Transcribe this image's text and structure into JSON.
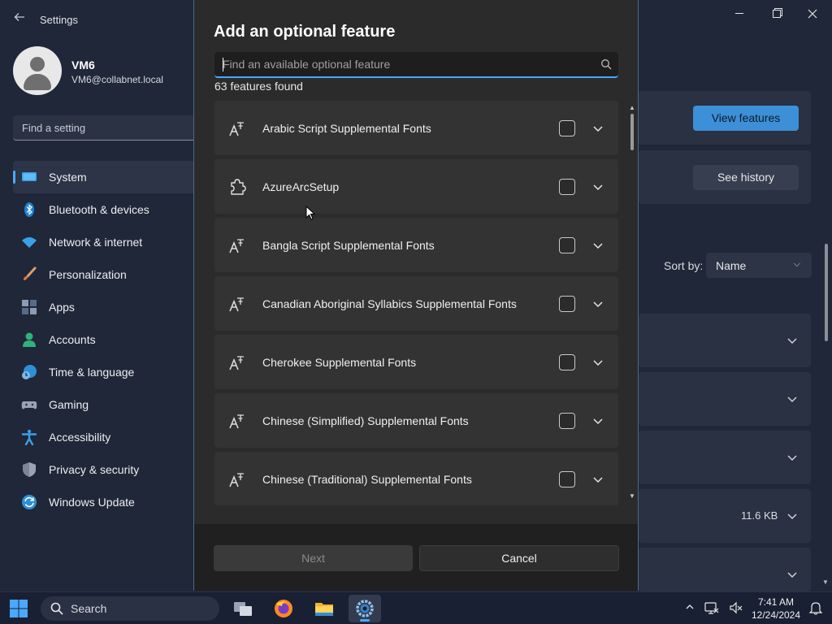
{
  "window": {
    "app_title": "Settings",
    "back_icon": "back-arrow-icon",
    "minimize_icon": "minimize-icon",
    "maximize_icon": "restore-icon",
    "close_icon": "close-icon"
  },
  "profile": {
    "name": "VM6",
    "email": "VM6@collabnet.local"
  },
  "search": {
    "placeholder": "Find a setting"
  },
  "sidebar": {
    "items": [
      {
        "label": "System",
        "icon": "system-monitor-icon",
        "active": true
      },
      {
        "label": "Bluetooth & devices",
        "icon": "bluetooth-icon"
      },
      {
        "label": "Network & internet",
        "icon": "wifi-icon"
      },
      {
        "label": "Personalization",
        "icon": "paintbrush-icon"
      },
      {
        "label": "Apps",
        "icon": "apps-icon"
      },
      {
        "label": "Accounts",
        "icon": "account-icon"
      },
      {
        "label": "Time & language",
        "icon": "globe-clock-icon"
      },
      {
        "label": "Gaming",
        "icon": "gamepad-icon"
      },
      {
        "label": "Accessibility",
        "icon": "accessibility-icon"
      },
      {
        "label": "Privacy & security",
        "icon": "shield-icon"
      },
      {
        "label": "Windows Update",
        "icon": "update-icon"
      }
    ]
  },
  "background_page": {
    "view_features_label": "View features",
    "see_history_label": "See history",
    "sort_by_label": "Sort by:",
    "sort_value": "Name",
    "size_label": "11.6 KB"
  },
  "dialog": {
    "title": "Add an optional feature",
    "search_placeholder": "Find an available optional feature",
    "found_count": "63 features found",
    "features": [
      {
        "label": "Arabic Script Supplemental Fonts",
        "icon": "font-icon"
      },
      {
        "label": "AzureArcSetup",
        "icon": "puzzle-icon"
      },
      {
        "label": "Bangla Script Supplemental Fonts",
        "icon": "font-icon"
      },
      {
        "label": "Canadian Aboriginal Syllabics Supplemental Fonts",
        "icon": "font-icon"
      },
      {
        "label": "Cherokee Supplemental Fonts",
        "icon": "font-icon"
      },
      {
        "label": "Chinese (Simplified) Supplemental Fonts",
        "icon": "font-icon"
      },
      {
        "label": "Chinese (Traditional) Supplemental Fonts",
        "icon": "font-icon"
      }
    ],
    "next_label": "Next",
    "cancel_label": "Cancel"
  },
  "taskbar": {
    "search_label": "Search",
    "time": "7:41 AM",
    "date": "12/24/2024",
    "apps": [
      "task-view-icon",
      "firefox-icon",
      "file-explorer-icon",
      "settings-icon"
    ]
  },
  "colors": {
    "accent": "#4aa8ff",
    "dialog_bg": "#2b2b2b",
    "row_bg": "#333333",
    "settings_bg": "#202738"
  }
}
